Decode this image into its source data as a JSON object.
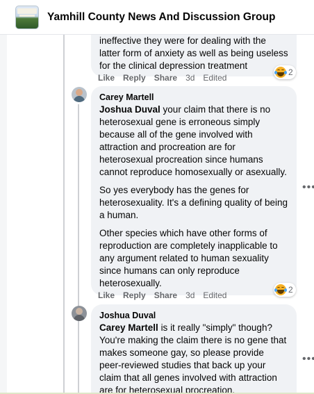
{
  "header": {
    "group_name": "Yamhill County News And Discussion Group"
  },
  "comments": [
    {
      "text": "ineffective they were for dealing with the latter form of anxiety as well as being useless for the clinical depression treatment",
      "actions": {
        "like": "Like",
        "reply": "Reply",
        "share": "Share",
        "time": "3d",
        "edited": "Edited"
      },
      "reaction": {
        "icon": "haha-icon",
        "count": "2"
      }
    },
    {
      "author": "Carey Martell",
      "mention": "Joshua Duval",
      "paragraph1": "your claim that there is no heterosexual gene is erroneous simply because all of the gene involved with attraction and procreation are for heterosexual procreation since humans cannot reproduce homosexually or asexually.",
      "paragraph2": "So yes everybody has the genes for heterosexuality. It's a defining quality of being a human.",
      "paragraph3": "Other species which have other forms of reproduction are completely inapplicable to any argument related to human sexuality since humans can only reproduce heterosexually.",
      "actions": {
        "like": "Like",
        "reply": "Reply",
        "share": "Share",
        "time": "3d",
        "edited": "Edited"
      },
      "reaction": {
        "icon": "haha-icon",
        "count": "2"
      }
    },
    {
      "author": "Joshua Duval",
      "mention": "Carey Martell",
      "text": "is it really \"simply\" though? You're making the claim there is no gene that makes someone gay, so please provide peer-reviewed studies that back up your claim that all genes involved with attraction are for heterosexual procreation."
    }
  ],
  "more_label": "•••"
}
